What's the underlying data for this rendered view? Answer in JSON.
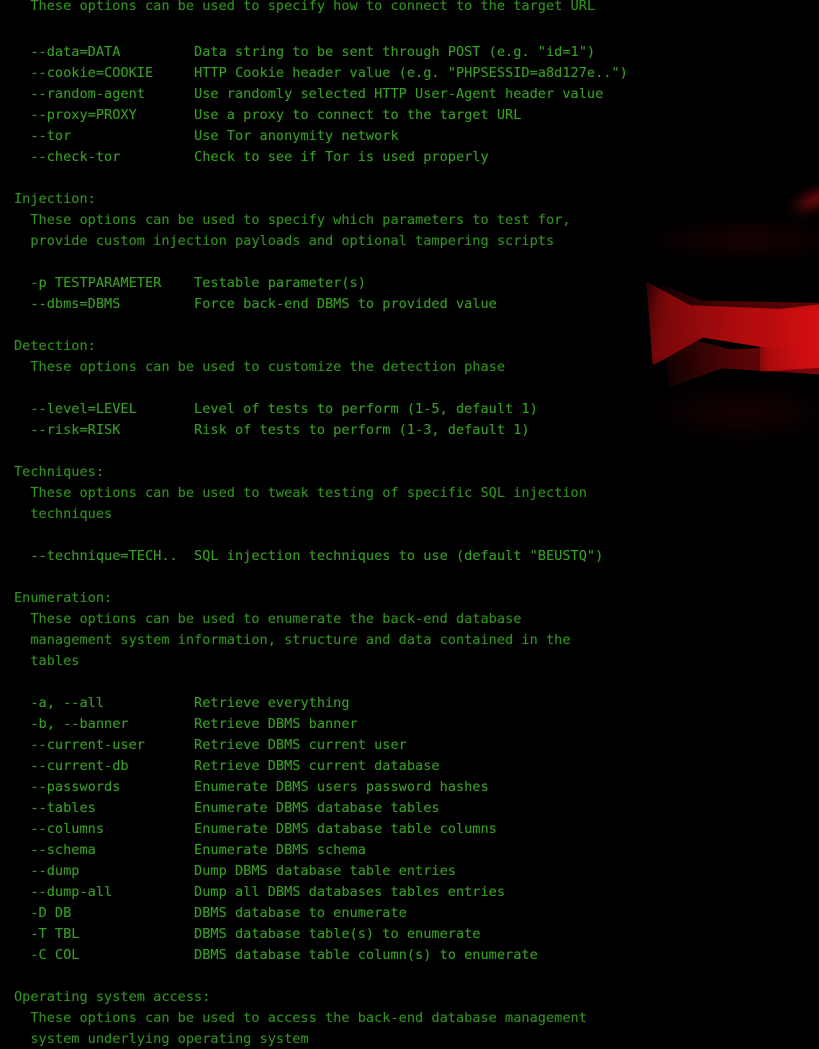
{
  "terminal": {
    "program": "sqlmap",
    "view": "help-output",
    "text_color": "#2f9e1e",
    "background_color": "#000000",
    "accent_color": "#cd0e10",
    "columns": 80,
    "option_column": 2,
    "description_column": 26
  },
  "wallpaper": {
    "shape_name": "red-glow-band",
    "color": "#cd0e10"
  },
  "lines": [
    {
      "kind": "desc",
      "text": "  These options can be used to specify how to connect to the target URL"
    },
    {
      "kind": "blank",
      "text": ""
    },
    {
      "kind": "opt",
      "text": "  --data=DATA         Data string to be sent through POST (e.g. \"id=1\")"
    },
    {
      "kind": "opt",
      "text": "  --cookie=COOKIE     HTTP Cookie header value (e.g. \"PHPSESSID=a8d127e..\")"
    },
    {
      "kind": "opt",
      "text": "  --random-agent      Use randomly selected HTTP User-Agent header value"
    },
    {
      "kind": "opt",
      "text": "  --proxy=PROXY       Use a proxy to connect to the target URL"
    },
    {
      "kind": "opt",
      "text": "  --tor               Use Tor anonymity network"
    },
    {
      "kind": "opt",
      "text": "  --check-tor         Check to see if Tor is used properly"
    },
    {
      "kind": "blank",
      "text": ""
    },
    {
      "kind": "section",
      "text": "Injection:"
    },
    {
      "kind": "desc",
      "text": "  These options can be used to specify which parameters to test for,"
    },
    {
      "kind": "desc",
      "text": "  provide custom injection payloads and optional tampering scripts"
    },
    {
      "kind": "blank",
      "text": ""
    },
    {
      "kind": "opt",
      "text": "  -p TESTPARAMETER    Testable parameter(s)"
    },
    {
      "kind": "opt",
      "text": "  --dbms=DBMS         Force back-end DBMS to provided value"
    },
    {
      "kind": "blank",
      "text": ""
    },
    {
      "kind": "section",
      "text": "Detection:"
    },
    {
      "kind": "desc",
      "text": "  These options can be used to customize the detection phase"
    },
    {
      "kind": "blank",
      "text": ""
    },
    {
      "kind": "opt",
      "text": "  --level=LEVEL       Level of tests to perform (1-5, default 1)"
    },
    {
      "kind": "opt",
      "text": "  --risk=RISK         Risk of tests to perform (1-3, default 1)"
    },
    {
      "kind": "blank",
      "text": ""
    },
    {
      "kind": "section",
      "text": "Techniques:"
    },
    {
      "kind": "desc",
      "text": "  These options can be used to tweak testing of specific SQL injection"
    },
    {
      "kind": "desc",
      "text": "  techniques"
    },
    {
      "kind": "blank",
      "text": ""
    },
    {
      "kind": "opt",
      "text": "  --technique=TECH..  SQL injection techniques to use (default \"BEUSTQ\")"
    },
    {
      "kind": "blank",
      "text": ""
    },
    {
      "kind": "section",
      "text": "Enumeration:"
    },
    {
      "kind": "desc",
      "text": "  These options can be used to enumerate the back-end database"
    },
    {
      "kind": "desc",
      "text": "  management system information, structure and data contained in the"
    },
    {
      "kind": "desc",
      "text": "  tables"
    },
    {
      "kind": "blank",
      "text": ""
    },
    {
      "kind": "opt",
      "text": "  -a, --all           Retrieve everything"
    },
    {
      "kind": "opt",
      "text": "  -b, --banner        Retrieve DBMS banner"
    },
    {
      "kind": "opt",
      "text": "  --current-user      Retrieve DBMS current user"
    },
    {
      "kind": "opt",
      "text": "  --current-db        Retrieve DBMS current database"
    },
    {
      "kind": "opt",
      "text": "  --passwords         Enumerate DBMS users password hashes"
    },
    {
      "kind": "opt",
      "text": "  --tables            Enumerate DBMS database tables"
    },
    {
      "kind": "opt",
      "text": "  --columns           Enumerate DBMS database table columns"
    },
    {
      "kind": "opt",
      "text": "  --schema            Enumerate DBMS schema"
    },
    {
      "kind": "opt",
      "text": "  --dump              Dump DBMS database table entries"
    },
    {
      "kind": "opt",
      "text": "  --dump-all          Dump all DBMS databases tables entries"
    },
    {
      "kind": "opt",
      "text": "  -D DB               DBMS database to enumerate"
    },
    {
      "kind": "opt",
      "text": "  -T TBL              DBMS database table(s) to enumerate"
    },
    {
      "kind": "opt",
      "text": "  -C COL              DBMS database table column(s) to enumerate"
    },
    {
      "kind": "blank",
      "text": ""
    },
    {
      "kind": "section",
      "text": "Operating system access:"
    },
    {
      "kind": "desc",
      "text": "  These options can be used to access the back-end database management"
    },
    {
      "kind": "desc",
      "text": "  system underlying operating system"
    }
  ]
}
